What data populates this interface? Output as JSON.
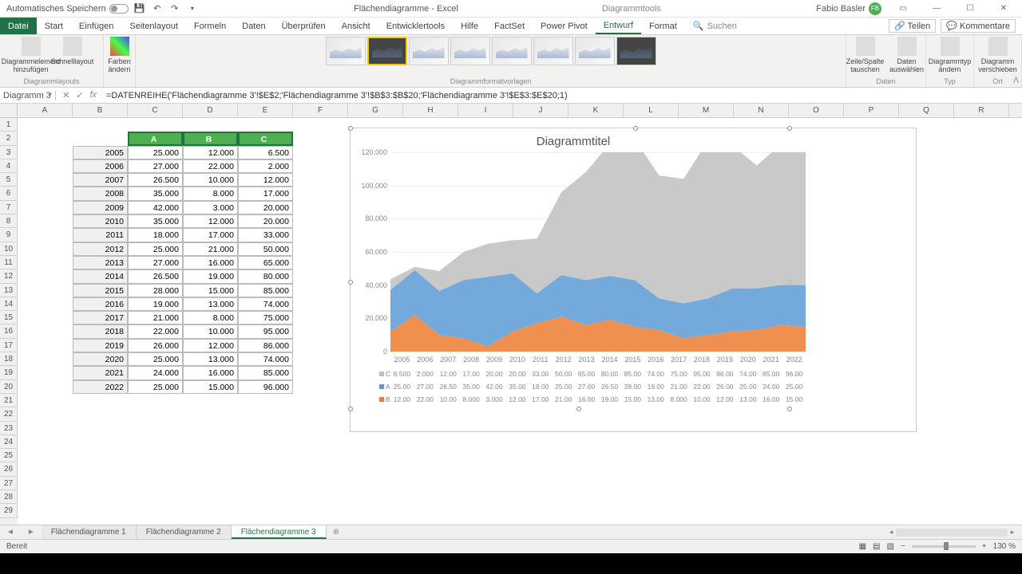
{
  "titlebar": {
    "autosave": "Automatisches Speichern",
    "title": "Flächendiagramme - Excel",
    "tools": "Diagrammtools",
    "user": "Fabio Basler",
    "initials": "FB"
  },
  "ribbon": {
    "tabs": [
      "Datei",
      "Start",
      "Einfügen",
      "Seitenlayout",
      "Formeln",
      "Daten",
      "Überprüfen",
      "Ansicht",
      "Entwicklertools",
      "Hilfe",
      "FactSet",
      "Power Pivot",
      "Entwurf",
      "Format"
    ],
    "search": "Suchen",
    "share": "Teilen",
    "comments": "Kommentare",
    "groups": {
      "layouts": "Diagrammlayouts",
      "styles": "Diagrammformatvorlagen",
      "data": "Daten",
      "type": "Typ",
      "loc": "Ort",
      "add_elem": "Diagrammelement hinzufügen",
      "quick": "Schnelllayout",
      "colors": "Farben ändern",
      "switch": "Zeile/Spalte tauschen",
      "select": "Daten auswählen",
      "change": "Diagrammtyp ändern",
      "move": "Diagramm verschieben"
    }
  },
  "formula": {
    "name": "Diagramm 3",
    "fx": "fx",
    "formula": "=DATENREIHE('Flächendiagramme 3'!$E$2;'Flächendiagramme 3'!$B$3:$B$20;'Flächendiagramme 3'!$E$3:$E$20;1)"
  },
  "columns": [
    "A",
    "B",
    "C",
    "D",
    "E",
    "F",
    "G",
    "H",
    "I",
    "J",
    "K",
    "L",
    "M",
    "N",
    "O",
    "P",
    "Q",
    "R"
  ],
  "table": {
    "headers": [
      "",
      "A",
      "B",
      "C"
    ],
    "rows": [
      [
        "2005",
        "25.000",
        "12.000",
        "6.500"
      ],
      [
        "2006",
        "27.000",
        "22.000",
        "2.000"
      ],
      [
        "2007",
        "26.500",
        "10.000",
        "12.000"
      ],
      [
        "2008",
        "35.000",
        "8.000",
        "17.000"
      ],
      [
        "2009",
        "42.000",
        "3.000",
        "20.000"
      ],
      [
        "2010",
        "35.000",
        "12.000",
        "20.000"
      ],
      [
        "2011",
        "18.000",
        "17.000",
        "33.000"
      ],
      [
        "2012",
        "25.000",
        "21.000",
        "50.000"
      ],
      [
        "2013",
        "27.000",
        "16.000",
        "65.000"
      ],
      [
        "2014",
        "26.500",
        "19.000",
        "80.000"
      ],
      [
        "2015",
        "28.000",
        "15.000",
        "85.000"
      ],
      [
        "2016",
        "19.000",
        "13.000",
        "74.000"
      ],
      [
        "2017",
        "21.000",
        "8.000",
        "75.000"
      ],
      [
        "2018",
        "22.000",
        "10.000",
        "95.000"
      ],
      [
        "2019",
        "26.000",
        "12.000",
        "86.000"
      ],
      [
        "2020",
        "25.000",
        "13.000",
        "74.000"
      ],
      [
        "2021",
        "24.000",
        "16.000",
        "85.000"
      ],
      [
        "2022",
        "25.000",
        "15.000",
        "96.000"
      ]
    ]
  },
  "chart_data": {
    "type": "area",
    "title": "Diagrammtitel",
    "categories": [
      "2005",
      "2006",
      "2007",
      "2008",
      "2009",
      "2010",
      "2011",
      "2012",
      "2013",
      "2014",
      "2015",
      "2016",
      "2017",
      "2018",
      "2019",
      "2020",
      "2021",
      "2022"
    ],
    "series": [
      {
        "name": "C",
        "values": [
          6500,
          2000,
          12000,
          17000,
          20000,
          20000,
          33000,
          50000,
          65000,
          80000,
          85000,
          74000,
          75000,
          95000,
          86000,
          74000,
          85000,
          96000
        ],
        "color": "#bfbfbf"
      },
      {
        "name": "A",
        "values": [
          25000,
          27000,
          26500,
          35000,
          42000,
          35000,
          18000,
          25000,
          27000,
          26500,
          28000,
          19000,
          21000,
          22000,
          26000,
          25000,
          24000,
          25000
        ],
        "color": "#5b9bd5"
      },
      {
        "name": "B",
        "values": [
          12000,
          22000,
          10000,
          8000,
          3000,
          12000,
          17000,
          21000,
          16000,
          19000,
          15000,
          13000,
          8000,
          10000,
          12000,
          13000,
          16000,
          15000
        ],
        "color": "#ed7d31"
      }
    ],
    "ylabel": "",
    "xlabel": "",
    "ylim": [
      0,
      120000
    ],
    "yticks": [
      0,
      20000,
      40000,
      60000,
      80000,
      100000,
      120000
    ],
    "ytick_labels": [
      "0",
      "20.000",
      "40.000",
      "60.000",
      "80.000",
      "100.000",
      "120.000"
    ],
    "data_table_rows": [
      {
        "key": "C",
        "swatch": "#bfbfbf",
        "vals": [
          "6.500",
          "2.000",
          "12.00",
          "17.00",
          "20.00",
          "20.00",
          "33.00",
          "50.00",
          "65.00",
          "80.00",
          "85.00",
          "74.00",
          "75.00",
          "95.00",
          "86.00",
          "74.00",
          "85.00",
          "96.00"
        ]
      },
      {
        "key": "A",
        "swatch": "#5b9bd5",
        "vals": [
          "25.00",
          "27.00",
          "26.50",
          "35.00",
          "42.00",
          "35.00",
          "18.00",
          "25.00",
          "27.00",
          "26.50",
          "28.00",
          "19.00",
          "21.00",
          "22.00",
          "26.00",
          "25.00",
          "24.00",
          "25.00"
        ]
      },
      {
        "key": "B",
        "swatch": "#ed7d31",
        "vals": [
          "12.00",
          "22.00",
          "10.00",
          "8.000",
          "3.000",
          "12.00",
          "17.00",
          "21.00",
          "16.00",
          "19.00",
          "15.00",
          "13.00",
          "8.000",
          "10.00",
          "12.00",
          "13.00",
          "16.00",
          "15.00"
        ]
      }
    ]
  },
  "sheets": {
    "tabs": [
      "Flächendiagramme 1",
      "Flächendiagramme 2",
      "Flächendiagramme 3"
    ],
    "active": 2
  },
  "statusbar": {
    "ready": "Bereit",
    "zoom": "130 %"
  }
}
